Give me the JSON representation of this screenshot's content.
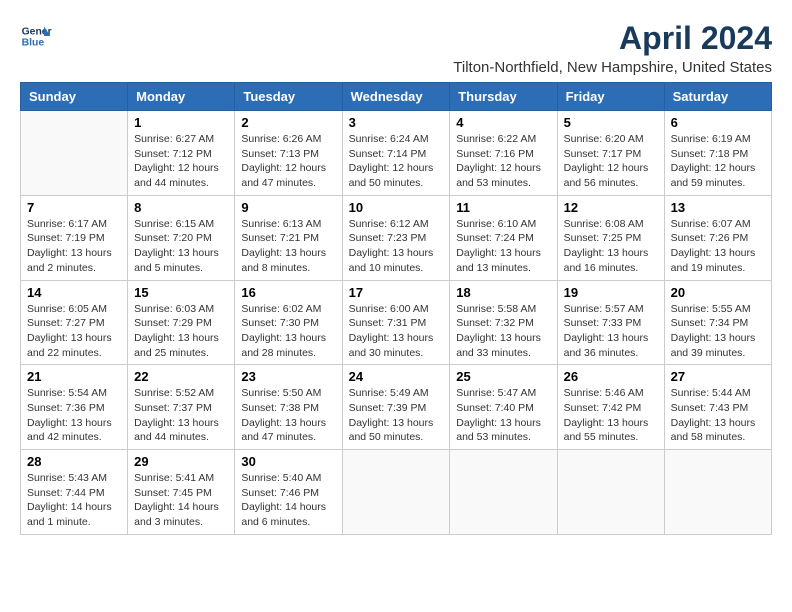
{
  "header": {
    "logo_line1": "General",
    "logo_line2": "Blue",
    "month_year": "April 2024",
    "location": "Tilton-Northfield, New Hampshire, United States"
  },
  "days_of_week": [
    "Sunday",
    "Monday",
    "Tuesday",
    "Wednesday",
    "Thursday",
    "Friday",
    "Saturday"
  ],
  "weeks": [
    [
      {
        "day": "",
        "info": ""
      },
      {
        "day": "1",
        "info": "Sunrise: 6:27 AM\nSunset: 7:12 PM\nDaylight: 12 hours\nand 44 minutes."
      },
      {
        "day": "2",
        "info": "Sunrise: 6:26 AM\nSunset: 7:13 PM\nDaylight: 12 hours\nand 47 minutes."
      },
      {
        "day": "3",
        "info": "Sunrise: 6:24 AM\nSunset: 7:14 PM\nDaylight: 12 hours\nand 50 minutes."
      },
      {
        "day": "4",
        "info": "Sunrise: 6:22 AM\nSunset: 7:16 PM\nDaylight: 12 hours\nand 53 minutes."
      },
      {
        "day": "5",
        "info": "Sunrise: 6:20 AM\nSunset: 7:17 PM\nDaylight: 12 hours\nand 56 minutes."
      },
      {
        "day": "6",
        "info": "Sunrise: 6:19 AM\nSunset: 7:18 PM\nDaylight: 12 hours\nand 59 minutes."
      }
    ],
    [
      {
        "day": "7",
        "info": "Sunrise: 6:17 AM\nSunset: 7:19 PM\nDaylight: 13 hours\nand 2 minutes."
      },
      {
        "day": "8",
        "info": "Sunrise: 6:15 AM\nSunset: 7:20 PM\nDaylight: 13 hours\nand 5 minutes."
      },
      {
        "day": "9",
        "info": "Sunrise: 6:13 AM\nSunset: 7:21 PM\nDaylight: 13 hours\nand 8 minutes."
      },
      {
        "day": "10",
        "info": "Sunrise: 6:12 AM\nSunset: 7:23 PM\nDaylight: 13 hours\nand 10 minutes."
      },
      {
        "day": "11",
        "info": "Sunrise: 6:10 AM\nSunset: 7:24 PM\nDaylight: 13 hours\nand 13 minutes."
      },
      {
        "day": "12",
        "info": "Sunrise: 6:08 AM\nSunset: 7:25 PM\nDaylight: 13 hours\nand 16 minutes."
      },
      {
        "day": "13",
        "info": "Sunrise: 6:07 AM\nSunset: 7:26 PM\nDaylight: 13 hours\nand 19 minutes."
      }
    ],
    [
      {
        "day": "14",
        "info": "Sunrise: 6:05 AM\nSunset: 7:27 PM\nDaylight: 13 hours\nand 22 minutes."
      },
      {
        "day": "15",
        "info": "Sunrise: 6:03 AM\nSunset: 7:29 PM\nDaylight: 13 hours\nand 25 minutes."
      },
      {
        "day": "16",
        "info": "Sunrise: 6:02 AM\nSunset: 7:30 PM\nDaylight: 13 hours\nand 28 minutes."
      },
      {
        "day": "17",
        "info": "Sunrise: 6:00 AM\nSunset: 7:31 PM\nDaylight: 13 hours\nand 30 minutes."
      },
      {
        "day": "18",
        "info": "Sunrise: 5:58 AM\nSunset: 7:32 PM\nDaylight: 13 hours\nand 33 minutes."
      },
      {
        "day": "19",
        "info": "Sunrise: 5:57 AM\nSunset: 7:33 PM\nDaylight: 13 hours\nand 36 minutes."
      },
      {
        "day": "20",
        "info": "Sunrise: 5:55 AM\nSunset: 7:34 PM\nDaylight: 13 hours\nand 39 minutes."
      }
    ],
    [
      {
        "day": "21",
        "info": "Sunrise: 5:54 AM\nSunset: 7:36 PM\nDaylight: 13 hours\nand 42 minutes."
      },
      {
        "day": "22",
        "info": "Sunrise: 5:52 AM\nSunset: 7:37 PM\nDaylight: 13 hours\nand 44 minutes."
      },
      {
        "day": "23",
        "info": "Sunrise: 5:50 AM\nSunset: 7:38 PM\nDaylight: 13 hours\nand 47 minutes."
      },
      {
        "day": "24",
        "info": "Sunrise: 5:49 AM\nSunset: 7:39 PM\nDaylight: 13 hours\nand 50 minutes."
      },
      {
        "day": "25",
        "info": "Sunrise: 5:47 AM\nSunset: 7:40 PM\nDaylight: 13 hours\nand 53 minutes."
      },
      {
        "day": "26",
        "info": "Sunrise: 5:46 AM\nSunset: 7:42 PM\nDaylight: 13 hours\nand 55 minutes."
      },
      {
        "day": "27",
        "info": "Sunrise: 5:44 AM\nSunset: 7:43 PM\nDaylight: 13 hours\nand 58 minutes."
      }
    ],
    [
      {
        "day": "28",
        "info": "Sunrise: 5:43 AM\nSunset: 7:44 PM\nDaylight: 14 hours\nand 1 minute."
      },
      {
        "day": "29",
        "info": "Sunrise: 5:41 AM\nSunset: 7:45 PM\nDaylight: 14 hours\nand 3 minutes."
      },
      {
        "day": "30",
        "info": "Sunrise: 5:40 AM\nSunset: 7:46 PM\nDaylight: 14 hours\nand 6 minutes."
      },
      {
        "day": "",
        "info": ""
      },
      {
        "day": "",
        "info": ""
      },
      {
        "day": "",
        "info": ""
      },
      {
        "day": "",
        "info": ""
      }
    ]
  ]
}
